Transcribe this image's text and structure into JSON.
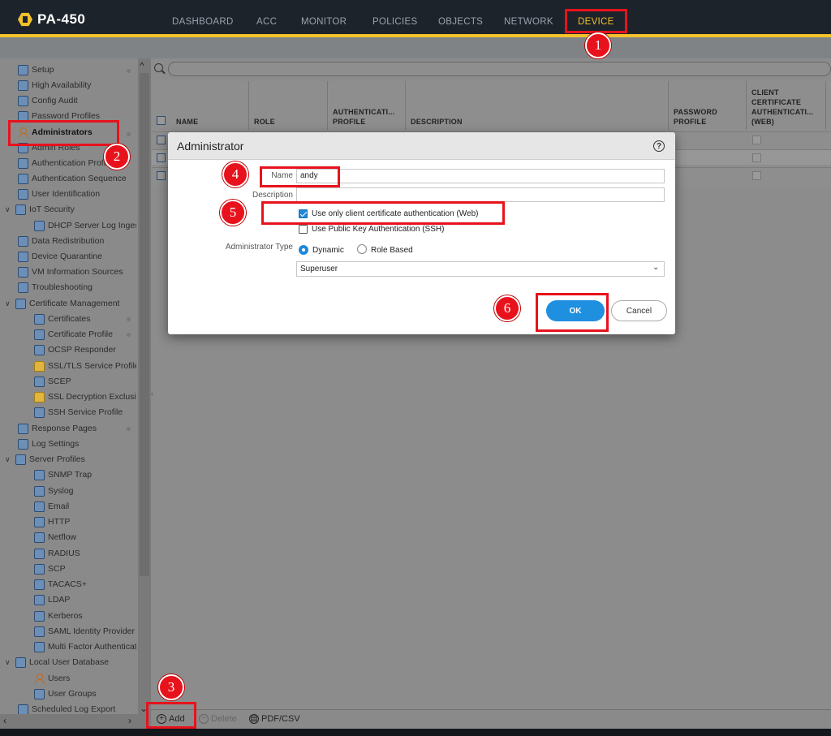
{
  "app": {
    "name": "PA-450",
    "nav_tabs": [
      "DASHBOARD",
      "ACC",
      "MONITOR",
      "POLICIES",
      "OBJECTS",
      "NETWORK",
      "DEVICE"
    ],
    "active_tab": "DEVICE"
  },
  "sidebar": {
    "items": [
      {
        "label": "Setup",
        "icon": "setup-icon"
      },
      {
        "label": "High Availability",
        "icon": "ha-icon"
      },
      {
        "label": "Config Audit",
        "icon": "audit-icon"
      },
      {
        "label": "Password Profiles",
        "icon": "password-icon"
      },
      {
        "label": "Administrators",
        "icon": "person-icon"
      },
      {
        "label": "Admin Roles",
        "icon": "roles-icon"
      },
      {
        "label": "Authentication Profile",
        "icon": "auth-icon"
      },
      {
        "label": "Authentication Sequence",
        "icon": "auth-seq-icon"
      },
      {
        "label": "User Identification",
        "icon": "user-id-icon"
      },
      {
        "label": "IoT Security",
        "icon": "iot-icon"
      },
      {
        "label": "DHCP Server Log Ingestion",
        "icon": "dhcp-icon"
      },
      {
        "label": "Data Redistribution",
        "icon": "redistribution-icon"
      },
      {
        "label": "Device Quarantine",
        "icon": "quarantine-icon"
      },
      {
        "label": "VM Information Sources",
        "icon": "vm-icon"
      },
      {
        "label": "Troubleshooting",
        "icon": "troubleshoot-icon"
      },
      {
        "label": "Certificate Management",
        "icon": "cert-mgmt-icon"
      },
      {
        "label": "Certificates",
        "icon": "cert-icon"
      },
      {
        "label": "Certificate Profile",
        "icon": "cert-profile-icon"
      },
      {
        "label": "OCSP Responder",
        "icon": "ocsp-icon"
      },
      {
        "label": "SSL/TLS Service Profile",
        "icon": "lock-icon"
      },
      {
        "label": "SCEP",
        "icon": "scep-icon"
      },
      {
        "label": "SSL Decryption Exclusion",
        "icon": "lock-icon"
      },
      {
        "label": "SSH Service Profile",
        "icon": "ssh-icon"
      },
      {
        "label": "Response Pages",
        "icon": "response-icon"
      },
      {
        "label": "Log Settings",
        "icon": "log-icon"
      },
      {
        "label": "Server Profiles",
        "icon": "server-icon"
      },
      {
        "label": "SNMP Trap",
        "icon": "snmp-icon"
      },
      {
        "label": "Syslog",
        "icon": "syslog-icon"
      },
      {
        "label": "Email",
        "icon": "email-icon"
      },
      {
        "label": "HTTP",
        "icon": "http-icon"
      },
      {
        "label": "Netflow",
        "icon": "netflow-icon"
      },
      {
        "label": "RADIUS",
        "icon": "radius-icon"
      },
      {
        "label": "SCP",
        "icon": "scp-icon"
      },
      {
        "label": "TACACS+",
        "icon": "tacacs-icon"
      },
      {
        "label": "LDAP",
        "icon": "ldap-icon"
      },
      {
        "label": "Kerberos",
        "icon": "kerberos-icon"
      },
      {
        "label": "SAML Identity Provider",
        "icon": "saml-icon"
      },
      {
        "label": "Multi Factor Authentication",
        "icon": "mfa-icon"
      },
      {
        "label": "Local User Database",
        "icon": "local-db-icon"
      },
      {
        "label": "Users",
        "icon": "person-icon"
      },
      {
        "label": "User Groups",
        "icon": "group-icon"
      },
      {
        "label": "Scheduled Log Export",
        "icon": "export-icon"
      }
    ]
  },
  "grid": {
    "columns": [
      "NAME",
      "ROLE",
      "AUTHENTICATI... PROFILE",
      "DESCRIPTION",
      "PASSWORD PROFILE",
      "CLIENT CERTIFICATE AUTHENTICATI... (WEB)"
    ]
  },
  "toolbar": {
    "add_label": "Add",
    "delete_label": "Delete",
    "export_label": "PDF/CSV"
  },
  "dialog": {
    "title": "Administrator",
    "name_label": "Name",
    "name_value": "andy",
    "description_label": "Description",
    "description_value": "",
    "client_cert_label": "Use only client certificate authentication (Web)",
    "client_cert_checked": true,
    "ssh_key_label": "Use Public Key Authentication (SSH)",
    "ssh_key_checked": false,
    "admin_type_label": "Administrator Type",
    "admin_type_options": [
      "Dynamic",
      "Role Based"
    ],
    "admin_type_selected": "Dynamic",
    "role_value": "Superuser",
    "ok_label": "OK",
    "cancel_label": "Cancel"
  },
  "annotations": {
    "steps": [
      "1",
      "2",
      "3",
      "4",
      "5",
      "6"
    ],
    "color": "#e8121c"
  },
  "colors": {
    "accent": "#f3c12b",
    "primary_button": "#1f8fe0",
    "nav_bg": "#1d232b"
  }
}
